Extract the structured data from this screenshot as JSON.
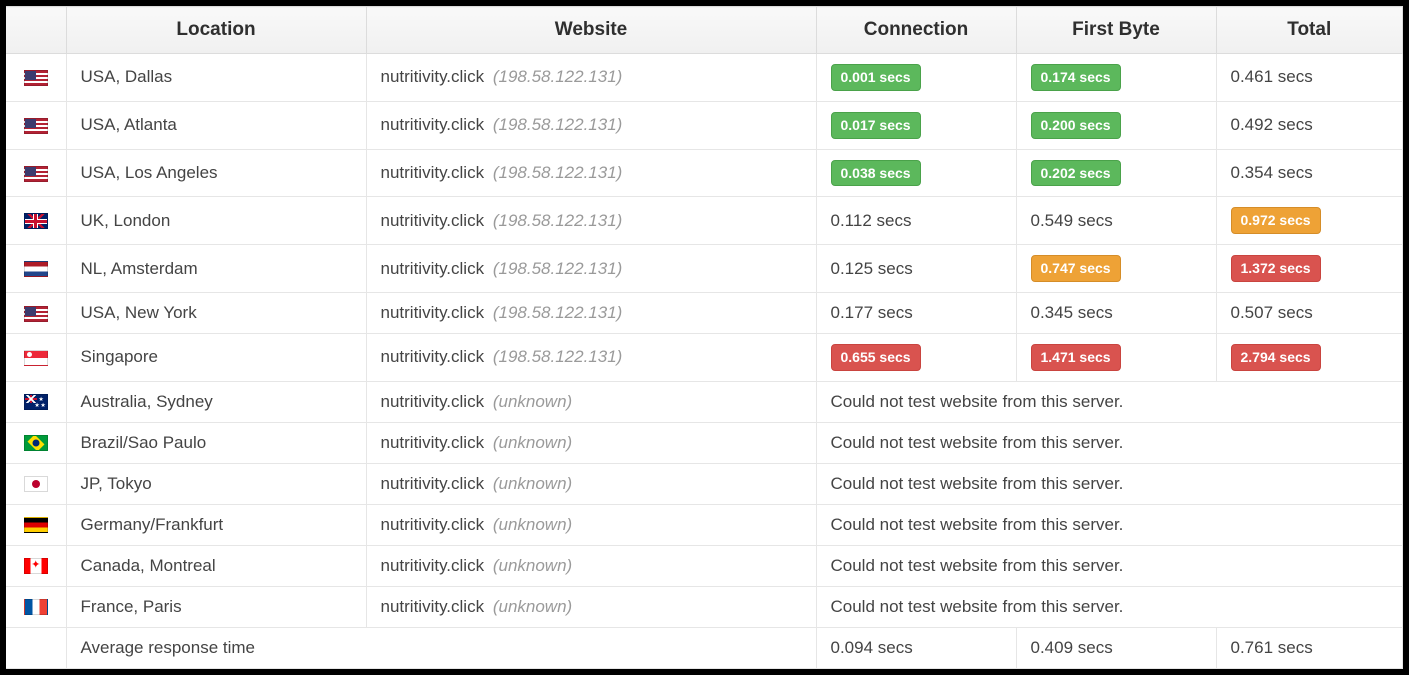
{
  "headers": {
    "flag": "",
    "location": "Location",
    "website": "Website",
    "connection": "Connection",
    "first_byte": "First Byte",
    "total": "Total"
  },
  "error_text": "Could not test website from this server.",
  "rows": [
    {
      "flag": "us",
      "location": "USA, Dallas",
      "site": "nutritivity.click",
      "ip": "(198.58.122.131)",
      "connection": {
        "text": "0.001 secs",
        "style": "green"
      },
      "first_byte": {
        "text": "0.174 secs",
        "style": "green"
      },
      "total": {
        "text": "0.461 secs",
        "style": "none"
      },
      "error": false
    },
    {
      "flag": "us",
      "location": "USA, Atlanta",
      "site": "nutritivity.click",
      "ip": "(198.58.122.131)",
      "connection": {
        "text": "0.017 secs",
        "style": "green"
      },
      "first_byte": {
        "text": "0.200 secs",
        "style": "green"
      },
      "total": {
        "text": "0.492 secs",
        "style": "none"
      },
      "error": false
    },
    {
      "flag": "us",
      "location": "USA, Los Angeles",
      "site": "nutritivity.click",
      "ip": "(198.58.122.131)",
      "connection": {
        "text": "0.038 secs",
        "style": "green"
      },
      "first_byte": {
        "text": "0.202 secs",
        "style": "green"
      },
      "total": {
        "text": "0.354 secs",
        "style": "none"
      },
      "error": false
    },
    {
      "flag": "gb",
      "location": "UK, London",
      "site": "nutritivity.click",
      "ip": "(198.58.122.131)",
      "connection": {
        "text": "0.112 secs",
        "style": "none"
      },
      "first_byte": {
        "text": "0.549 secs",
        "style": "none"
      },
      "total": {
        "text": "0.972 secs",
        "style": "orange"
      },
      "error": false
    },
    {
      "flag": "nl",
      "location": "NL, Amsterdam",
      "site": "nutritivity.click",
      "ip": "(198.58.122.131)",
      "connection": {
        "text": "0.125 secs",
        "style": "none"
      },
      "first_byte": {
        "text": "0.747 secs",
        "style": "orange"
      },
      "total": {
        "text": "1.372 secs",
        "style": "red"
      },
      "error": false
    },
    {
      "flag": "us",
      "location": "USA, New York",
      "site": "nutritivity.click",
      "ip": "(198.58.122.131)",
      "connection": {
        "text": "0.177 secs",
        "style": "none"
      },
      "first_byte": {
        "text": "0.345 secs",
        "style": "none"
      },
      "total": {
        "text": "0.507 secs",
        "style": "none"
      },
      "error": false
    },
    {
      "flag": "sg",
      "location": "Singapore",
      "site": "nutritivity.click",
      "ip": "(198.58.122.131)",
      "connection": {
        "text": "0.655 secs",
        "style": "red"
      },
      "first_byte": {
        "text": "1.471 secs",
        "style": "red"
      },
      "total": {
        "text": "2.794 secs",
        "style": "red"
      },
      "error": false
    },
    {
      "flag": "au",
      "location": "Australia, Sydney",
      "site": "nutritivity.click",
      "ip": "(unknown)",
      "error": true
    },
    {
      "flag": "br",
      "location": "Brazil/Sao Paulo",
      "site": "nutritivity.click",
      "ip": "(unknown)",
      "error": true
    },
    {
      "flag": "jp",
      "location": "JP, Tokyo",
      "site": "nutritivity.click",
      "ip": "(unknown)",
      "error": true
    },
    {
      "flag": "de",
      "location": "Germany/Frankfurt",
      "site": "nutritivity.click",
      "ip": "(unknown)",
      "error": true
    },
    {
      "flag": "ca",
      "location": "Canada, Montreal",
      "site": "nutritivity.click",
      "ip": "(unknown)",
      "error": true
    },
    {
      "flag": "fr",
      "location": "France, Paris",
      "site": "nutritivity.click",
      "ip": "(unknown)",
      "error": true
    }
  ],
  "footer": {
    "label": "Average response time",
    "connection": "0.094 secs",
    "first_byte": "0.409 secs",
    "total": "0.761 secs"
  }
}
